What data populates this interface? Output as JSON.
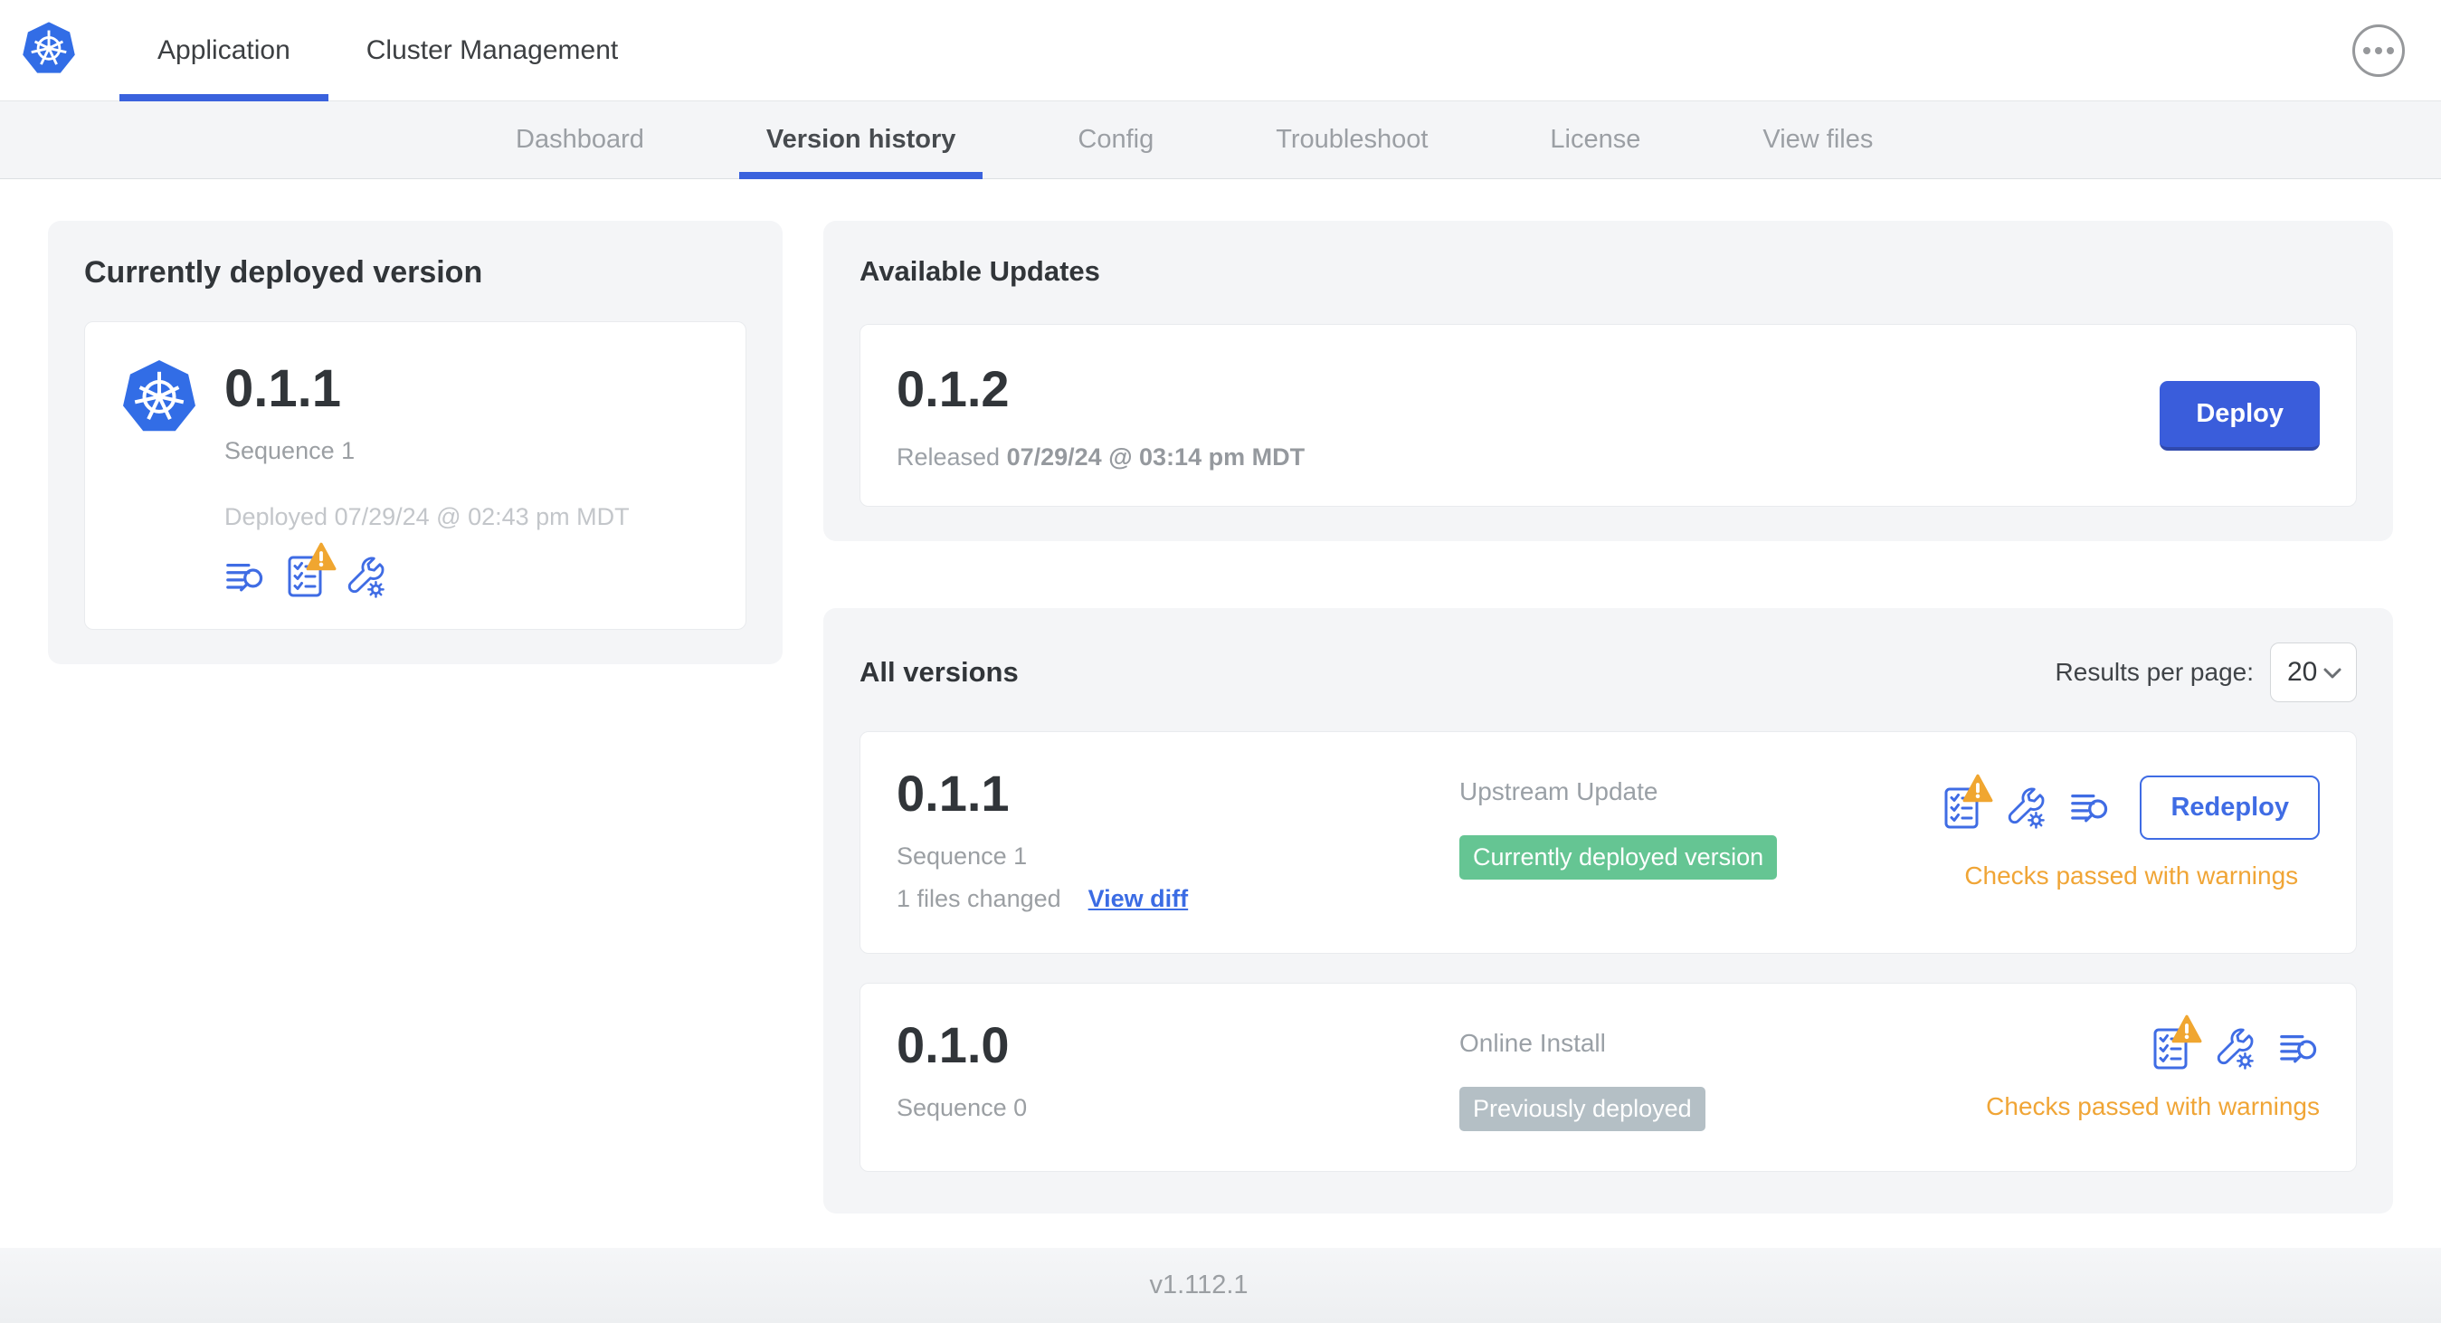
{
  "header": {
    "tabs": [
      {
        "label": "Application",
        "active": true
      },
      {
        "label": "Cluster Management",
        "active": false
      }
    ]
  },
  "subnav": {
    "tabs": [
      {
        "label": "Dashboard",
        "active": false
      },
      {
        "label": "Version history",
        "active": true
      },
      {
        "label": "Config",
        "active": false
      },
      {
        "label": "Troubleshoot",
        "active": false
      },
      {
        "label": "License",
        "active": false
      },
      {
        "label": "View files",
        "active": false
      }
    ]
  },
  "current_version_card": {
    "title": "Currently deployed version",
    "version": "0.1.1",
    "sequence": "Sequence 1",
    "deployed": "Deployed 07/29/24 @ 02:43 pm MDT"
  },
  "available_updates": {
    "title": "Available Updates",
    "version": "0.1.2",
    "released_prefix": "Released",
    "released_date": "07/29/24 @ 03:14 pm MDT",
    "deploy_label": "Deploy"
  },
  "all_versions": {
    "title": "All versions",
    "results_per_page_label": "Results per page:",
    "results_per_page_value": "20",
    "rows": [
      {
        "version": "0.1.1",
        "sequence": "Sequence 1",
        "files_changed": "1 files changed",
        "view_diff_label": "View diff",
        "source": "Upstream Update",
        "badge": "Currently deployed version",
        "status": "Checks passed with warnings",
        "action_label": "Redeploy"
      },
      {
        "version": "0.1.0",
        "sequence": "Sequence 0",
        "source": "Online Install",
        "badge": "Previously deployed",
        "status": "Checks passed with warnings"
      }
    ]
  },
  "footer": {
    "app_version": "v1.112.1"
  },
  "icons": {
    "logo": "kubernetes-logo",
    "menu": "ellipsis-menu-icon",
    "release_notes": "release-notes-icon",
    "preflight": "preflight-checklist-icon",
    "config": "config-wrench-icon",
    "warning": "warning-triangle-icon",
    "dropdown": "chevron-down-icon"
  },
  "colors": {
    "accent_blue": "#3a62dd",
    "button_blue": "#3a5ddb",
    "icon_blue": "#3f6ce4",
    "badge_green": "#65c593",
    "badge_gray": "#b4bfc5",
    "warning_amber": "#f0a536",
    "card_bg": "#f4f5f7"
  }
}
